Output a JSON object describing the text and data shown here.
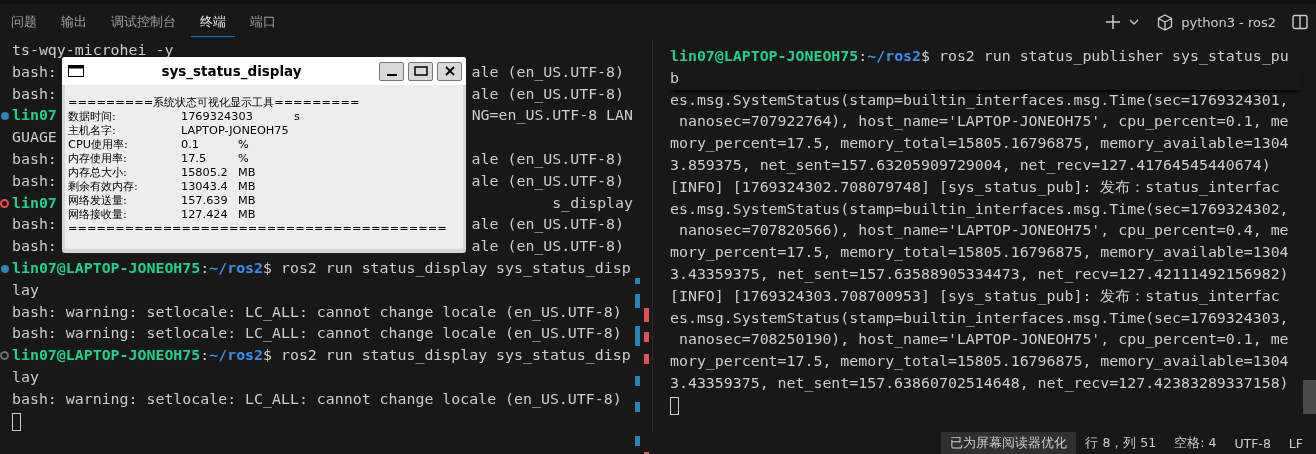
{
  "tabs": [
    {
      "label": "问题",
      "selected": false
    },
    {
      "label": "输出",
      "selected": false
    },
    {
      "label": "调试控制台",
      "selected": false
    },
    {
      "label": "终端",
      "selected": true
    },
    {
      "label": "端口",
      "selected": false
    }
  ],
  "terminal_name": "python3 - ros2",
  "left_terminal": {
    "lines": [
      {
        "kind": "plain",
        "text": "ts-wqy-microhei -y"
      },
      {
        "kind": "covered",
        "text": "bash:",
        "tail": "ale (en_US.UTF-8)"
      },
      {
        "kind": "covered",
        "text": "bash:",
        "tail": "ale (en_US.UTF-8)"
      },
      {
        "kind": "covered_prompt",
        "user": "lin07",
        "tail": "NG=en_US.UTF-8 LAN",
        "color": "#2b84b8",
        "filled": true
      },
      {
        "kind": "covered",
        "text": "GUAGE"
      },
      {
        "kind": "covered",
        "text": "bash:",
        "tail": "ale (en_US.UTF-8)"
      },
      {
        "kind": "covered",
        "text": "bash:",
        "tail": "ale (en_US.UTF-8)"
      },
      {
        "kind": "covered_prompt",
        "user": "lin07",
        "tail": "s_display",
        "color": "#f14c4c",
        "filled": false
      },
      {
        "kind": "covered",
        "text": "bash:",
        "tail": "ale (en_US.UTF-8)"
      },
      {
        "kind": "covered",
        "text": "bash:",
        "tail": "ale (en_US.UTF-8)"
      },
      {
        "kind": "prompt",
        "user": "lin07@LAPTOP-JONEOH75",
        "sep": ":",
        "path": "~/ros2",
        "command": "$ ros2 run status_display sys_status_disp",
        "color": "#2b84b8",
        "filled": true
      },
      {
        "kind": "plain",
        "text": "lay"
      },
      {
        "kind": "plain",
        "text": "bash: warning: setlocale: LC_ALL: cannot change locale (en_US.UTF-8)"
      },
      {
        "kind": "plain",
        "text": "bash: warning: setlocale: LC_ALL: cannot change locale (en_US.UTF-8)"
      },
      {
        "kind": "prompt",
        "user": "lin07@LAPTOP-JONEOH75",
        "sep": ":",
        "path": "~/ros2",
        "command": "$ ros2 run status_display sys_status_disp",
        "color": "#6e6e6e",
        "filled": false
      },
      {
        "kind": "plain",
        "text": "lay"
      },
      {
        "kind": "plain",
        "text": "bash: warning: setlocale: LC_ALL: cannot change locale (en_US.UTF-8)"
      },
      {
        "kind": "cursor"
      }
    ]
  },
  "right_terminal": {
    "lines": [
      {
        "kind": "prompt",
        "user": "lin07@LAPTOP-JONEOH75",
        "sep": ":",
        "path": "~/ros2",
        "command": "$ ros2 run status_publisher sys_status_pu"
      },
      {
        "kind": "plain",
        "text": "b"
      },
      {
        "kind": "plain",
        "text": "es.msg.SystemStatus(stamp=builtin_interfaces.msg.Time(sec=1769324301,"
      },
      {
        "kind": "plain",
        "text": " nanosec=707922764), host_name='LAPTOP-JONEOH75', cpu_percent=0.1, me"
      },
      {
        "kind": "plain",
        "text": "mory_percent=17.5, memory_total=15805.16796875, memory_available=1304"
      },
      {
        "kind": "plain",
        "text": "3.859375, net_sent=157.63205909729004, net_recv=127.41764545440674)"
      },
      {
        "kind": "plain",
        "text": "[INFO] [1769324302.708079748] [sys_status_pub]: 发布：status_interfac"
      },
      {
        "kind": "plain",
        "text": "es.msg.SystemStatus(stamp=builtin_interfaces.msg.Time(sec=1769324302,"
      },
      {
        "kind": "plain",
        "text": " nanosec=707820566), host_name='LAPTOP-JONEOH75', cpu_percent=0.4, me"
      },
      {
        "kind": "plain",
        "text": "mory_percent=17.5, memory_total=15805.16796875, memory_available=1304"
      },
      {
        "kind": "plain",
        "text": "3.43359375, net_sent=157.63588905334473, net_recv=127.42111492156982)"
      },
      {
        "kind": "plain",
        "text": "[INFO] [1769324303.708700953] [sys_status_pub]: 发布：status_interfac"
      },
      {
        "kind": "plain",
        "text": "es.msg.SystemStatus(stamp=builtin_interfaces.msg.Time(sec=1769324303,"
      },
      {
        "kind": "plain",
        "text": " nanosec=708250190), host_name='LAPTOP-JONEOH75', cpu_percent=0.1, me"
      },
      {
        "kind": "plain",
        "text": "mory_percent=17.5, memory_total=15805.16796875, memory_available=1304"
      },
      {
        "kind": "plain",
        "text": "3.43359375, net_sent=157.63860702514648, net_recv=127.42383289337158)"
      },
      {
        "kind": "cursor"
      }
    ]
  },
  "popup": {
    "title": "sys_status_display",
    "header": "=========系统状态可视化显示工具=========",
    "rows": [
      {
        "label": "数据时间:",
        "value": "1769324303",
        "unit": "s"
      },
      {
        "label": "主机名字:",
        "value": "LAPTOP-JONEOH75"
      },
      {
        "label": "CPU使用率:",
        "value": "0.1",
        "unit": "%"
      },
      {
        "label": "内存使用率:",
        "value": "17.5",
        "unit": "%"
      },
      {
        "label": "内存总大小:",
        "value": "15805.2",
        "unit": "MB"
      },
      {
        "label": "剩余有效内存:",
        "value": "13043.4",
        "unit": "MB"
      },
      {
        "label": "网络发送量:",
        "value": "157.639",
        "unit": "MB"
      },
      {
        "label": "网络接收量:",
        "value": "127.424",
        "unit": "MB"
      }
    ],
    "footer": "========================================"
  },
  "status_bar": [
    "已为屏幕阅读器优化",
    "行 8，列 51",
    "空格: 4",
    "UTF-8",
    "LF"
  ]
}
